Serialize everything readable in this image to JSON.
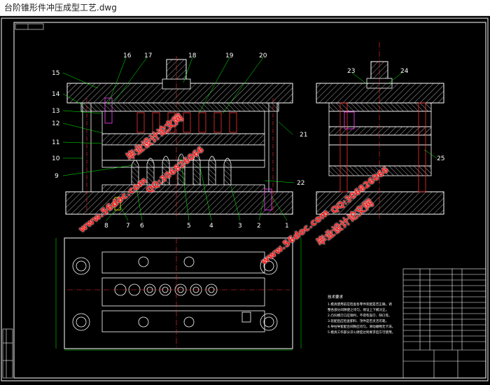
{
  "window": {
    "title": "台阶锥形件冲压成型工艺.dwg"
  },
  "drawing": {
    "callouts": [
      "1",
      "2",
      "3",
      "4",
      "5",
      "6",
      "7",
      "8",
      "9",
      "10",
      "11",
      "12",
      "13",
      "14",
      "15",
      "16",
      "17",
      "18",
      "19",
      "20",
      "21",
      "22",
      "23",
      "24",
      "25"
    ],
    "watermarks": [
      {
        "text": "毕业设计论文网"
      },
      {
        "text": "www.56doc.com"
      },
      {
        "text": "QQ:306826066"
      }
    ],
    "tech_notes": [
      "技术要求",
      "1.模具使用前应检查各零件装配是否正确，调",
      "   整各部分间隙使之均匀，保证上下模对正。",
      "2.凸凹模刃口应锋利，不得有崩刃、缺口等。",
      "3.装配后应检查卸料、顶件是否灵活可靠。",
      "4.导柱导套配合间隙应均匀，滑动顺畅无卡滞。",
      "5.模具工作部分淬火硬度达到要求后方可使用。"
    ]
  },
  "colors": {
    "background": "#000000",
    "outline": "#ffffff",
    "leader": "#00ff00",
    "hatch": "#d0d0d0",
    "watermark": "#ff2020",
    "center_line": "#ff3030"
  }
}
